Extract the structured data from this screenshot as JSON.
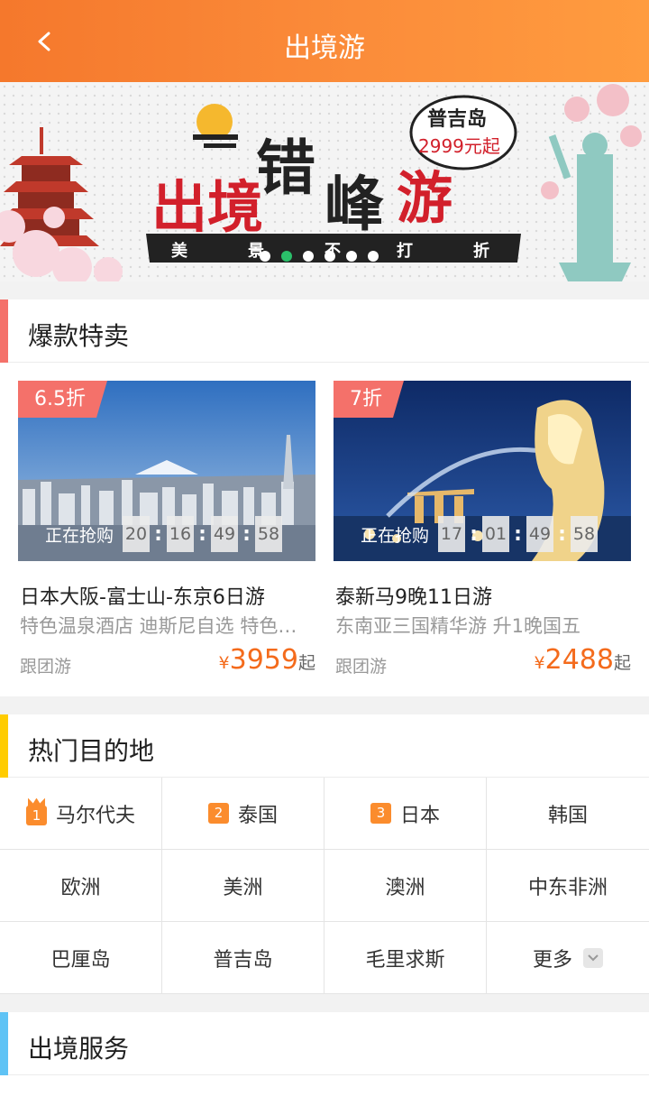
{
  "header": {
    "title": "出境游",
    "back_icon": "chevron-left-icon"
  },
  "banner": {
    "slides": 6,
    "active_index": 1,
    "headline": "出境错峰游",
    "tagline": "美景不打折",
    "badge_place": "普吉岛",
    "badge_price": "2999元起"
  },
  "hot_deals": {
    "title": "爆款特卖",
    "accent": "#f4716a",
    "cards": [
      {
        "discount": "6.5折",
        "countdown_label": "正在抢购",
        "countdown": [
          "20",
          "16",
          "49",
          "58"
        ],
        "name": "日本大阪-富士山-东京6日游",
        "desc": "特色温泉酒店 迪斯尼自选 特色温泉酒店",
        "type": "跟团游",
        "currency": "¥",
        "price": "3959",
        "price_suffix": "起"
      },
      {
        "discount": "7折",
        "countdown_label": "正在抢购",
        "countdown": [
          "17",
          "01",
          "49",
          "58"
        ],
        "name": "泰新马9晚11日游",
        "desc": "东南亚三国精华游  升1晚国五",
        "type": "跟团游",
        "currency": "¥",
        "price": "2488",
        "price_suffix": "起"
      }
    ]
  },
  "destinations": {
    "title": "热门目的地",
    "accent": "#ffcc00",
    "items": [
      {
        "label": "马尔代夫",
        "rank": "1"
      },
      {
        "label": "泰国",
        "rank": "2"
      },
      {
        "label": "日本",
        "rank": "3"
      },
      {
        "label": "韩国"
      },
      {
        "label": "欧洲"
      },
      {
        "label": "美洲"
      },
      {
        "label": "澳洲"
      },
      {
        "label": "中东非洲"
      },
      {
        "label": "巴厘岛"
      },
      {
        "label": "普吉岛"
      },
      {
        "label": "毛里求斯"
      },
      {
        "label": "更多"
      }
    ]
  },
  "services": {
    "title": "出境服务",
    "accent": "#5fc3f5"
  },
  "colors": {
    "header": "#f7822f",
    "price": "#f46b1c",
    "rank": "#fb8c2d"
  }
}
